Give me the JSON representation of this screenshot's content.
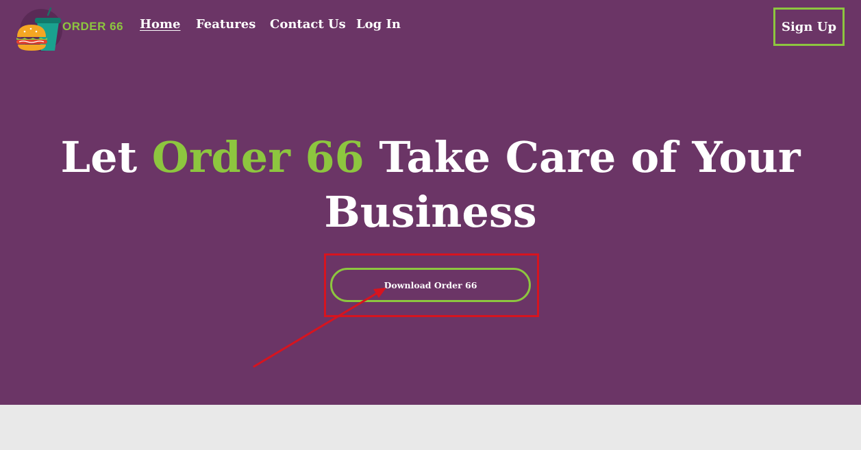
{
  "brand": {
    "name": "ORDER 66",
    "logo_icon": "burger-and-drink-logo"
  },
  "nav": {
    "items": [
      {
        "label": "Home",
        "active": true
      },
      {
        "label": "Features",
        "active": false
      },
      {
        "label": "Contact Us",
        "active": false
      },
      {
        "label": "Log In",
        "active": false
      }
    ],
    "signup_label": "Sign Up"
  },
  "hero": {
    "headline_prefix": "Let ",
    "headline_accent": "Order 66",
    "headline_suffix": " Take Care of Your Business",
    "cta_label": "Download Order 66"
  },
  "annotation": {
    "highlight_target": "download-button",
    "arrow_direction": "pointing-up-right"
  },
  "colors": {
    "hero_background": "#6b3566",
    "accent_green": "#8dc63f",
    "annotation_red": "#d7141f",
    "page_background": "#e9e9e9"
  }
}
